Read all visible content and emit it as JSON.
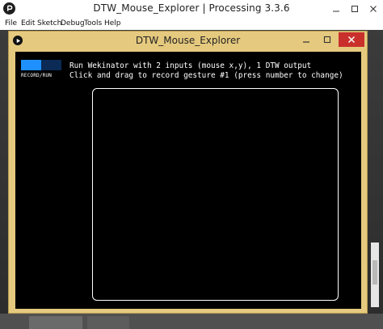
{
  "ide": {
    "title": "DTW_Mouse_Explorer | Processing 3.3.6",
    "menu": [
      "File",
      "Edit",
      "Sketch",
      "Debug",
      "Tools",
      "Help"
    ]
  },
  "sketch_window": {
    "title": "DTW_Mouse_Explorer",
    "record_run_label": "RECORD/RUN",
    "record_progress": 0.5,
    "instruction_line1": "Run Wekinator with 2 inputs (mouse x,y), 1 DTW output",
    "instruction_line2": "Click and drag to record gesture #1 (press number to change)"
  },
  "colors": {
    "sketch_frame": "#e5c97e",
    "close_button": "#c9302c",
    "record_fill": "#1e90ff",
    "record_track": "#0b2a55",
    "canvas_bg": "#000000"
  },
  "icons": [
    "processing-logo-icon",
    "minimize-icon",
    "maximize-icon",
    "close-icon"
  ]
}
